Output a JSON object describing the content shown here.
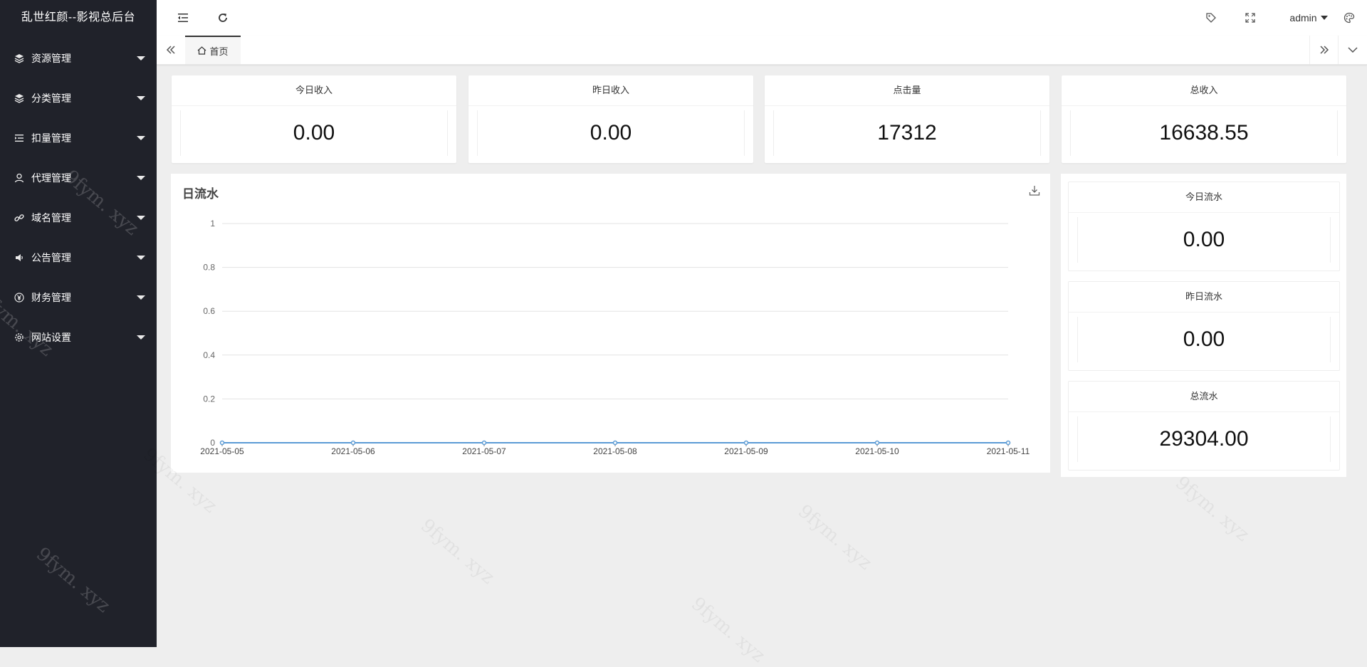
{
  "app": {
    "title": "乱世红颜--影视总后台"
  },
  "sidebar": {
    "items": [
      {
        "label": "资源管理",
        "icon": "layers-icon"
      },
      {
        "label": "分类管理",
        "icon": "layers-icon"
      },
      {
        "label": "扣量管理",
        "icon": "list-indent-icon"
      },
      {
        "label": "代理管理",
        "icon": "user-icon"
      },
      {
        "label": "域名管理",
        "icon": "link-icon"
      },
      {
        "label": "公告管理",
        "icon": "speaker-icon"
      },
      {
        "label": "财务管理",
        "icon": "yen-icon"
      },
      {
        "label": "网站设置",
        "icon": "gear-icon"
      }
    ]
  },
  "header": {
    "user": "admin"
  },
  "tabs": {
    "home": "首页"
  },
  "stats": [
    {
      "label": "今日收入",
      "value": "0.00"
    },
    {
      "label": "昨日收入",
      "value": "0.00"
    },
    {
      "label": "点击量",
      "value": "17312"
    },
    {
      "label": "总收入",
      "value": "16638.55"
    }
  ],
  "flow": [
    {
      "label": "今日流水",
      "value": "0.00"
    },
    {
      "label": "昨日流水",
      "value": "0.00"
    },
    {
      "label": "总流水",
      "value": "29304.00"
    }
  ],
  "watermark_text": "9fym. xyz",
  "chart_data": {
    "type": "line",
    "title": "日流水",
    "x": [
      "2021-05-05",
      "2021-05-06",
      "2021-05-07",
      "2021-05-08",
      "2021-05-09",
      "2021-05-10",
      "2021-05-11"
    ],
    "series": [
      {
        "values": [
          0,
          0,
          0,
          0,
          0,
          0,
          0
        ],
        "color": "#5b9bd5"
      }
    ],
    "ylim": [
      0,
      1
    ],
    "yticks": [
      "0",
      "0.2",
      "0.4",
      "0.6",
      "0.8",
      "1"
    ],
    "grid": true
  }
}
